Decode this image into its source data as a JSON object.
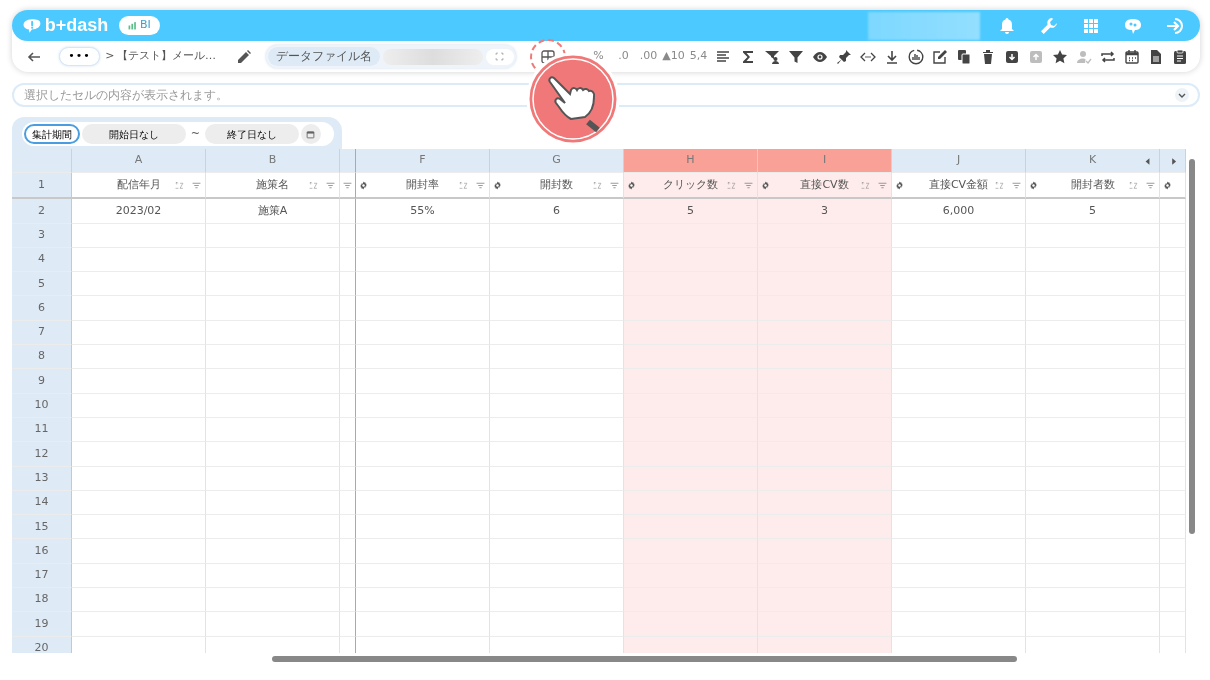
{
  "header": {
    "logo": "b+dash",
    "badge": "BI"
  },
  "breadcrumb": {
    "more": "•••",
    "separator": ">",
    "title": "【テスト】メール…"
  },
  "data_file": {
    "label": "データファイル名"
  },
  "toolbar": [
    {
      "kind": "icon",
      "disabled": false,
      "highlighted": true
    },
    {
      "kind": "text",
      "label": "%",
      "disabled": true
    },
    {
      "kind": "text",
      "label": ".0",
      "disabled": true
    },
    {
      "kind": "text",
      "label": ".00",
      "disabled": true
    },
    {
      "kind": "text",
      "label": "▲10",
      "disabled": true
    },
    {
      "kind": "text",
      "label": "5,4",
      "disabled": true
    },
    {
      "kind": "icon",
      "disabled": false
    },
    {
      "kind": "icon",
      "disabled": false
    },
    {
      "kind": "icon",
      "disabled": false
    },
    {
      "kind": "icon",
      "disabled": false
    },
    {
      "kind": "icon",
      "disabled": false
    },
    {
      "kind": "icon",
      "disabled": false
    },
    {
      "kind": "icon",
      "disabled": false
    },
    {
      "kind": "icon",
      "disabled": false
    },
    {
      "kind": "icon",
      "disabled": false
    },
    {
      "kind": "icon",
      "disabled": false
    },
    {
      "kind": "icon",
      "disabled": false
    },
    {
      "kind": "icon",
      "disabled": false
    },
    {
      "kind": "icon",
      "disabled": false
    },
    {
      "kind": "icon",
      "disabled": true
    },
    {
      "kind": "icon",
      "disabled": false
    },
    {
      "kind": "icon",
      "disabled": true
    },
    {
      "kind": "icon",
      "disabled": false
    },
    {
      "kind": "icon",
      "disabled": false
    },
    {
      "kind": "icon",
      "disabled": false
    },
    {
      "kind": "icon",
      "disabled": false
    }
  ],
  "formula_bar": {
    "placeholder": "選択したセルの内容が表示されます。"
  },
  "period": {
    "label": "集計期間",
    "start": "開始日なし",
    "separator": "~",
    "end": "終了日なし"
  },
  "columns": [
    {
      "kind": "full",
      "letter": "A",
      "field": "配信年月",
      "gear": false,
      "selected": false
    },
    {
      "kind": "full",
      "letter": "B",
      "field": "施策名",
      "gear": false,
      "selected": false
    },
    {
      "kind": "hidden"
    },
    {
      "kind": "full",
      "letter": "F",
      "field": "開封率",
      "gear": true,
      "selected": false
    },
    {
      "kind": "full",
      "letter": "G",
      "field": "開封数",
      "gear": true,
      "selected": false
    },
    {
      "kind": "full",
      "letter": "H",
      "field": "クリック数",
      "gear": true,
      "selected": true
    },
    {
      "kind": "full",
      "letter": "I",
      "field": "直接CV数",
      "gear": true,
      "selected": true
    },
    {
      "kind": "full",
      "letter": "J",
      "field": "直接CV金額",
      "gear": true,
      "selected": false
    },
    {
      "kind": "last",
      "letter": "K",
      "field": "開封者数",
      "gear": true,
      "selected": false
    },
    {
      "kind": "partial",
      "gear": true
    }
  ],
  "header_row": "1",
  "rows": [
    {
      "number": "2",
      "cells": [
        "2023/02",
        "施策A",
        "",
        "55%",
        "6",
        "5",
        "3",
        "6,000",
        "5",
        ""
      ]
    },
    {
      "number": "3"
    },
    {
      "number": "4"
    },
    {
      "number": "5"
    },
    {
      "number": "6"
    },
    {
      "number": "7"
    },
    {
      "number": "8"
    },
    {
      "number": "9"
    },
    {
      "number": "10"
    },
    {
      "number": "11"
    },
    {
      "number": "12"
    },
    {
      "number": "13"
    },
    {
      "number": "14"
    },
    {
      "number": "15"
    },
    {
      "number": "16"
    },
    {
      "number": "17"
    },
    {
      "number": "18"
    },
    {
      "number": "19"
    },
    {
      "number": "20"
    }
  ]
}
